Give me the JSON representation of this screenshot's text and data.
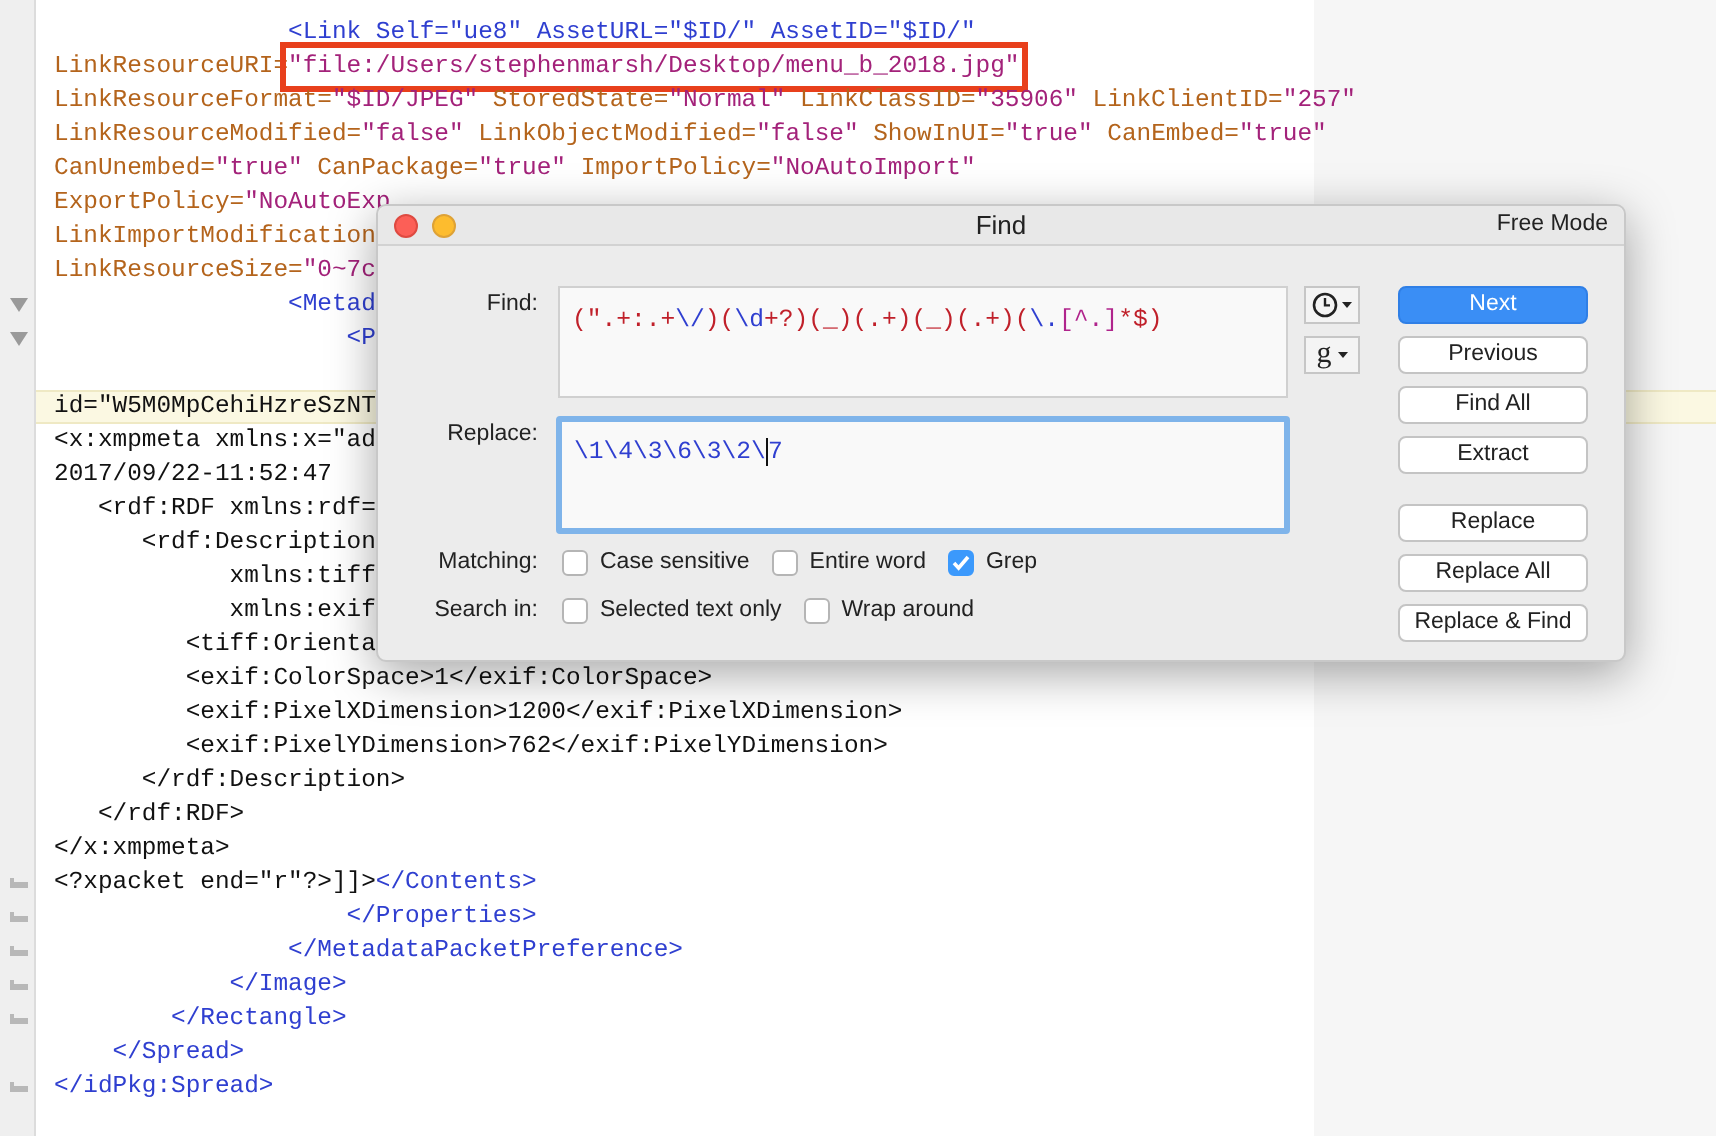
{
  "editor": {
    "lines": [
      {
        "kind": "text",
        "current": false,
        "segments": [
          {
            "kind": "tag",
            "text": "                <Link Self=\"ue8\" AssetURL=\"$ID/\" AssetID=\"$ID/\""
          }
        ]
      },
      {
        "kind": "text",
        "current": false,
        "segments": [
          {
            "kind": "attr",
            "text": "LinkResourceURI="
          },
          {
            "kind": "string",
            "text": "\"file:/Users/stephenmarsh/Desktop/menu_b_2018.jpg\"",
            "boxed": true
          }
        ]
      },
      {
        "kind": "text",
        "current": false,
        "segments": [
          {
            "kind": "attr",
            "text": "LinkResourceFormat="
          },
          {
            "kind": "string",
            "text": "\"$ID/JPEG\""
          },
          {
            "kind": "attr",
            "text": " StoredState="
          },
          {
            "kind": "string",
            "text": "\"Normal\""
          },
          {
            "kind": "attr",
            "text": " LinkClassID="
          },
          {
            "kind": "string",
            "text": "\"35906\""
          },
          {
            "kind": "attr",
            "text": " LinkClientID="
          },
          {
            "kind": "string",
            "text": "\"257\""
          }
        ]
      },
      {
        "kind": "text",
        "current": false,
        "segments": [
          {
            "kind": "attr",
            "text": "LinkResourceModified="
          },
          {
            "kind": "string",
            "text": "\"false\""
          },
          {
            "kind": "attr",
            "text": " LinkObjectModified="
          },
          {
            "kind": "string",
            "text": "\"false\""
          },
          {
            "kind": "attr",
            "text": " ShowInUI="
          },
          {
            "kind": "string",
            "text": "\"true\""
          },
          {
            "kind": "attr",
            "text": " CanEmbed="
          },
          {
            "kind": "string",
            "text": "\"true\""
          }
        ]
      },
      {
        "kind": "text",
        "current": false,
        "segments": [
          {
            "kind": "attr",
            "text": "CanUnembed="
          },
          {
            "kind": "string",
            "text": "\"true\""
          },
          {
            "kind": "attr",
            "text": " CanPackage="
          },
          {
            "kind": "string",
            "text": "\"true\""
          },
          {
            "kind": "attr",
            "text": " ImportPolicy="
          },
          {
            "kind": "string",
            "text": "\"NoAutoImport\""
          }
        ]
      },
      {
        "kind": "text",
        "current": false,
        "segments": [
          {
            "kind": "attr",
            "text": "ExportPolicy="
          },
          {
            "kind": "string",
            "text": "\"NoAutoExp"
          }
        ]
      },
      {
        "kind": "text",
        "current": false,
        "segments": [
          {
            "kind": "attr",
            "text": "LinkImportModification"
          }
        ]
      },
      {
        "kind": "text",
        "current": false,
        "segments": [
          {
            "kind": "attr",
            "text": "LinkResourceSize="
          },
          {
            "kind": "string",
            "text": "\"0~7c"
          }
        ]
      },
      {
        "kind": "fold_start",
        "current": false,
        "segments": [
          {
            "kind": "tag",
            "text": "                <Metad"
          }
        ]
      },
      {
        "kind": "fold_start",
        "current": false,
        "segments": [
          {
            "kind": "tag",
            "text": "                    <P"
          }
        ]
      },
      {
        "kind": "text",
        "current": false
      },
      {
        "kind": "text",
        "current": true,
        "segments": [
          {
            "kind": "plain",
            "text": "id=\"W5M0MpCehiHzreSzNT"
          }
        ]
      },
      {
        "kind": "text",
        "current": false,
        "segments": [
          {
            "kind": "plain",
            "text": "<x:xmpmeta xmlns:x=\"ad"
          }
        ]
      },
      {
        "kind": "text",
        "current": false,
        "segments": [
          {
            "kind": "plain",
            "text": "2017/09/22-11:52:47"
          }
        ]
      },
      {
        "kind": "text",
        "current": false,
        "segments": [
          {
            "kind": "plain",
            "text": "   <rdf:RDF xmlns:rdf="
          }
        ]
      },
      {
        "kind": "text",
        "current": false,
        "segments": [
          {
            "kind": "plain",
            "text": "      <rdf:Description"
          }
        ]
      },
      {
        "kind": "text",
        "current": false,
        "segments": [
          {
            "kind": "plain",
            "text": "            xmlns:tiff"
          }
        ]
      },
      {
        "kind": "text",
        "current": false,
        "segments": [
          {
            "kind": "plain",
            "text": "            xmlns:exif"
          }
        ]
      },
      {
        "kind": "text",
        "current": false,
        "segments": [
          {
            "kind": "plain",
            "text": "         <tiff:Orienta"
          }
        ]
      },
      {
        "kind": "text",
        "current": false,
        "segments": [
          {
            "kind": "plain",
            "text": "         <exif:ColorSpace>1</exif:ColorSpace>"
          }
        ]
      },
      {
        "kind": "text",
        "current": false,
        "segments": [
          {
            "kind": "plain",
            "text": "         <exif:PixelXDimension>1200</exif:PixelXDimension>"
          }
        ]
      },
      {
        "kind": "text",
        "current": false,
        "segments": [
          {
            "kind": "plain",
            "text": "         <exif:PixelYDimension>762</exif:PixelYDimension>"
          }
        ]
      },
      {
        "kind": "text",
        "current": false,
        "segments": [
          {
            "kind": "plain",
            "text": "      </rdf:Description>"
          }
        ]
      },
      {
        "kind": "text",
        "current": false,
        "segments": [
          {
            "kind": "plain",
            "text": "   </rdf:RDF>"
          }
        ]
      },
      {
        "kind": "text",
        "current": false,
        "segments": [
          {
            "kind": "plain",
            "text": "</x:xmpmeta>"
          }
        ]
      },
      {
        "kind": "fold_end",
        "current": false,
        "segments": [
          {
            "kind": "plain",
            "text": "<?xpacket end=\"r\"?>]]>"
          },
          {
            "kind": "tag",
            "text": "</Contents>"
          }
        ]
      },
      {
        "kind": "fold_end",
        "current": false,
        "segments": [
          {
            "kind": "tag",
            "text": "                    </Properties>"
          }
        ]
      },
      {
        "kind": "fold_end",
        "current": false,
        "segments": [
          {
            "kind": "tag",
            "text": "                </MetadataPacketPreference>"
          }
        ]
      },
      {
        "kind": "fold_end",
        "current": false,
        "segments": [
          {
            "kind": "tag",
            "text": "            </Image>"
          }
        ]
      },
      {
        "kind": "fold_end",
        "current": false,
        "segments": [
          {
            "kind": "tag",
            "text": "        </Rectangle>"
          }
        ]
      },
      {
        "kind": "text",
        "current": false,
        "segments": [
          {
            "kind": "tag",
            "text": "    </Spread>"
          }
        ]
      },
      {
        "kind": "fold_end",
        "current": false,
        "segments": [
          {
            "kind": "tag",
            "text": "</idPkg:Spread>"
          }
        ]
      }
    ]
  },
  "dialog": {
    "title": "Find",
    "mode": "Free Mode",
    "find": {
      "label": "Find:",
      "segments": [
        {
          "kind": "group",
          "text": "(\".+:.+"
        },
        {
          "kind": "escape",
          "text": "\\/"
        },
        {
          "kind": "group",
          "text": ")("
        },
        {
          "kind": "escape",
          "text": "\\d"
        },
        {
          "kind": "group",
          "text": "+?)(_)(.+)(_)(.+)("
        },
        {
          "kind": "escape",
          "text": "\\."
        },
        {
          "kind": "class",
          "text": "[^.]"
        },
        {
          "kind": "group",
          "text": "*$)"
        }
      ]
    },
    "replace": {
      "label": "Replace:",
      "value_before_caret": "\\1\\4\\3\\6\\3\\2\\",
      "value_after_caret": "7",
      "focused": true
    },
    "tools": [
      {
        "kind": "history"
      },
      {
        "kind": "grep_menu",
        "text": "g"
      }
    ],
    "matching": {
      "label": "Matching:",
      "options": [
        {
          "label": "Case sensitive",
          "checked": false
        },
        {
          "label": "Entire word",
          "checked": false
        },
        {
          "label": "Grep",
          "checked": true
        }
      ]
    },
    "search_in": {
      "label": "Search in:",
      "options": [
        {
          "label": "Selected text only",
          "checked": false
        },
        {
          "label": "Wrap around",
          "checked": false
        }
      ]
    },
    "button_groups": [
      [
        {
          "label": "Next",
          "default": true
        },
        {
          "label": "Previous",
          "default": false
        },
        {
          "label": "Find All",
          "default": false
        },
        {
          "label": "Extract",
          "default": false
        }
      ],
      [
        {
          "label": "Replace",
          "default": false
        },
        {
          "label": "Replace All",
          "default": false
        },
        {
          "label": "Replace & Find",
          "default": false
        }
      ]
    ]
  }
}
